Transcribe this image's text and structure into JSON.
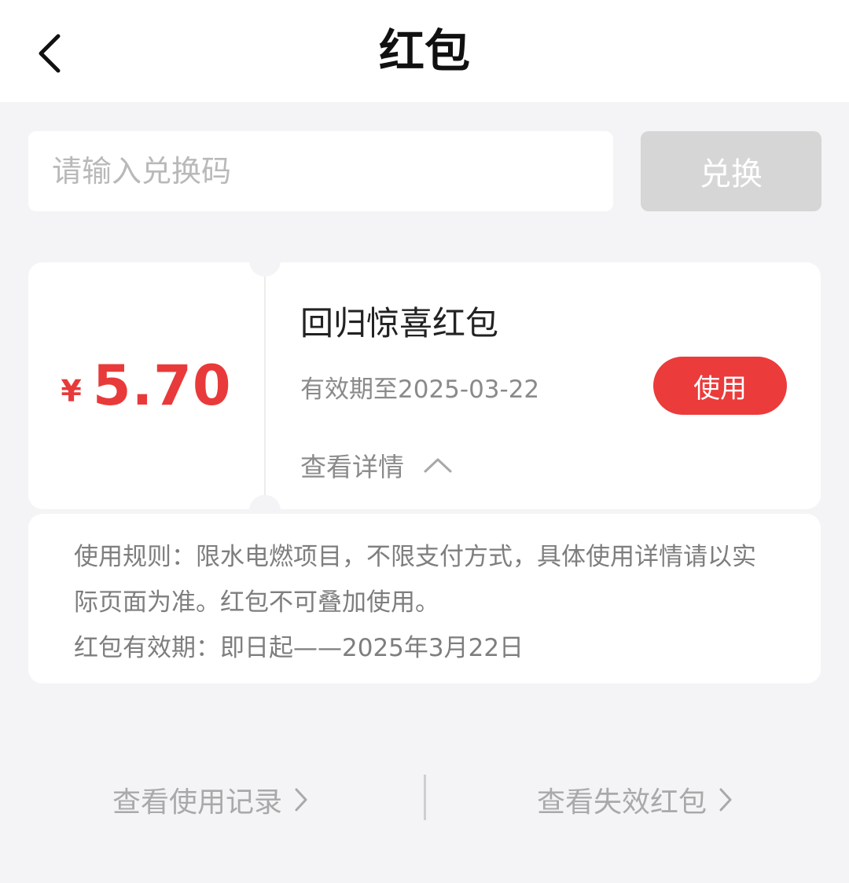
{
  "header": {
    "title": "红包",
    "back_icon": "chevron-left-icon"
  },
  "redeem": {
    "placeholder": "请输入兑换码",
    "button_label": "兑换"
  },
  "coupon": {
    "currency": "¥",
    "amount": "5.70",
    "title": "回归惊喜红包",
    "expiry": "有效期至2025-03-22",
    "use_label": "使用",
    "details_label": "查看详情",
    "details_icon": "chevron-up-icon",
    "accent_color": "#eb3b3b"
  },
  "rules": {
    "text": "使用规则：限水电燃项目，不限支付方式，具体使用详情请以实际页面为准。红包不可叠加使用。",
    "validity": "红包有效期：即日起——2025年3月22日"
  },
  "footer": {
    "usage_record_label": "查看使用记录",
    "expired_label": "查看失效红包",
    "link_icon": "chevron-right-icon"
  }
}
